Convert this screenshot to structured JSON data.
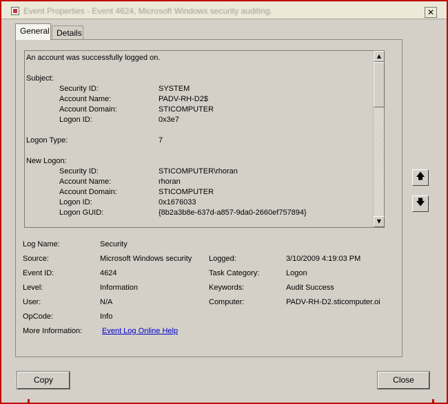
{
  "window": {
    "title": "Event Properties - Event 4624, Microsoft Windows security auditing.",
    "close_glyph": "✕"
  },
  "tabs": [
    {
      "label": "General",
      "selected": true
    },
    {
      "label": "Details",
      "selected": false
    }
  ],
  "message": {
    "headline": "An account was successfully logged on.",
    "subject_heading": "Subject:",
    "subject": [
      {
        "label": "Security ID:",
        "value": "SYSTEM"
      },
      {
        "label": "Account Name:",
        "value": "PADV-RH-D2$"
      },
      {
        "label": "Account Domain:",
        "value": "STICOMPUTER"
      },
      {
        "label": "Logon ID:",
        "value": "0x3e7"
      }
    ],
    "logon_type_label": "Logon Type:",
    "logon_type_value": "7",
    "new_logon_heading": "New Logon:",
    "new_logon": [
      {
        "label": "Security ID:",
        "value": "STICOMPUTER\\rhoran"
      },
      {
        "label": "Account Name:",
        "value": "rhoran"
      },
      {
        "label": "Account Domain:",
        "value": "STICOMPUTER"
      },
      {
        "label": "Logon ID:",
        "value": "0x1676033"
      },
      {
        "label": "Logon GUID:",
        "value": "{8b2a3b8e-637d-a857-9da0-2660ef757894}"
      }
    ]
  },
  "scroll": {
    "up_glyph": "▲",
    "down_glyph": "▼"
  },
  "nav": {
    "up_glyph": "🡅",
    "down_glyph": "🡇"
  },
  "details": {
    "log_name_label": "Log Name:",
    "log_name_value": "Security",
    "source_label": "Source:",
    "source_value": "Microsoft Windows security",
    "logged_label": "Logged:",
    "logged_value": "3/10/2009 4:19:03 PM",
    "event_id_label": "Event ID:",
    "event_id_value": "4624",
    "task_category_label": "Task Category:",
    "task_category_value": "Logon",
    "level_label": "Level:",
    "level_value": "Information",
    "keywords_label": "Keywords:",
    "keywords_value": "Audit Success",
    "user_label": "User:",
    "user_value": "N/A",
    "computer_label": "Computer:",
    "computer_value": "PADV-RH-D2.sticomputer.oi",
    "opcode_label": "OpCode:",
    "opcode_value": "Info",
    "more_info_label": "More Information:",
    "more_info_link": "Event Log Online Help"
  },
  "buttons": {
    "copy": "Copy",
    "close": "Close"
  },
  "colors": {
    "accent_red": "#c00000",
    "link": "#0000cc",
    "face": "#d4d0c8"
  }
}
